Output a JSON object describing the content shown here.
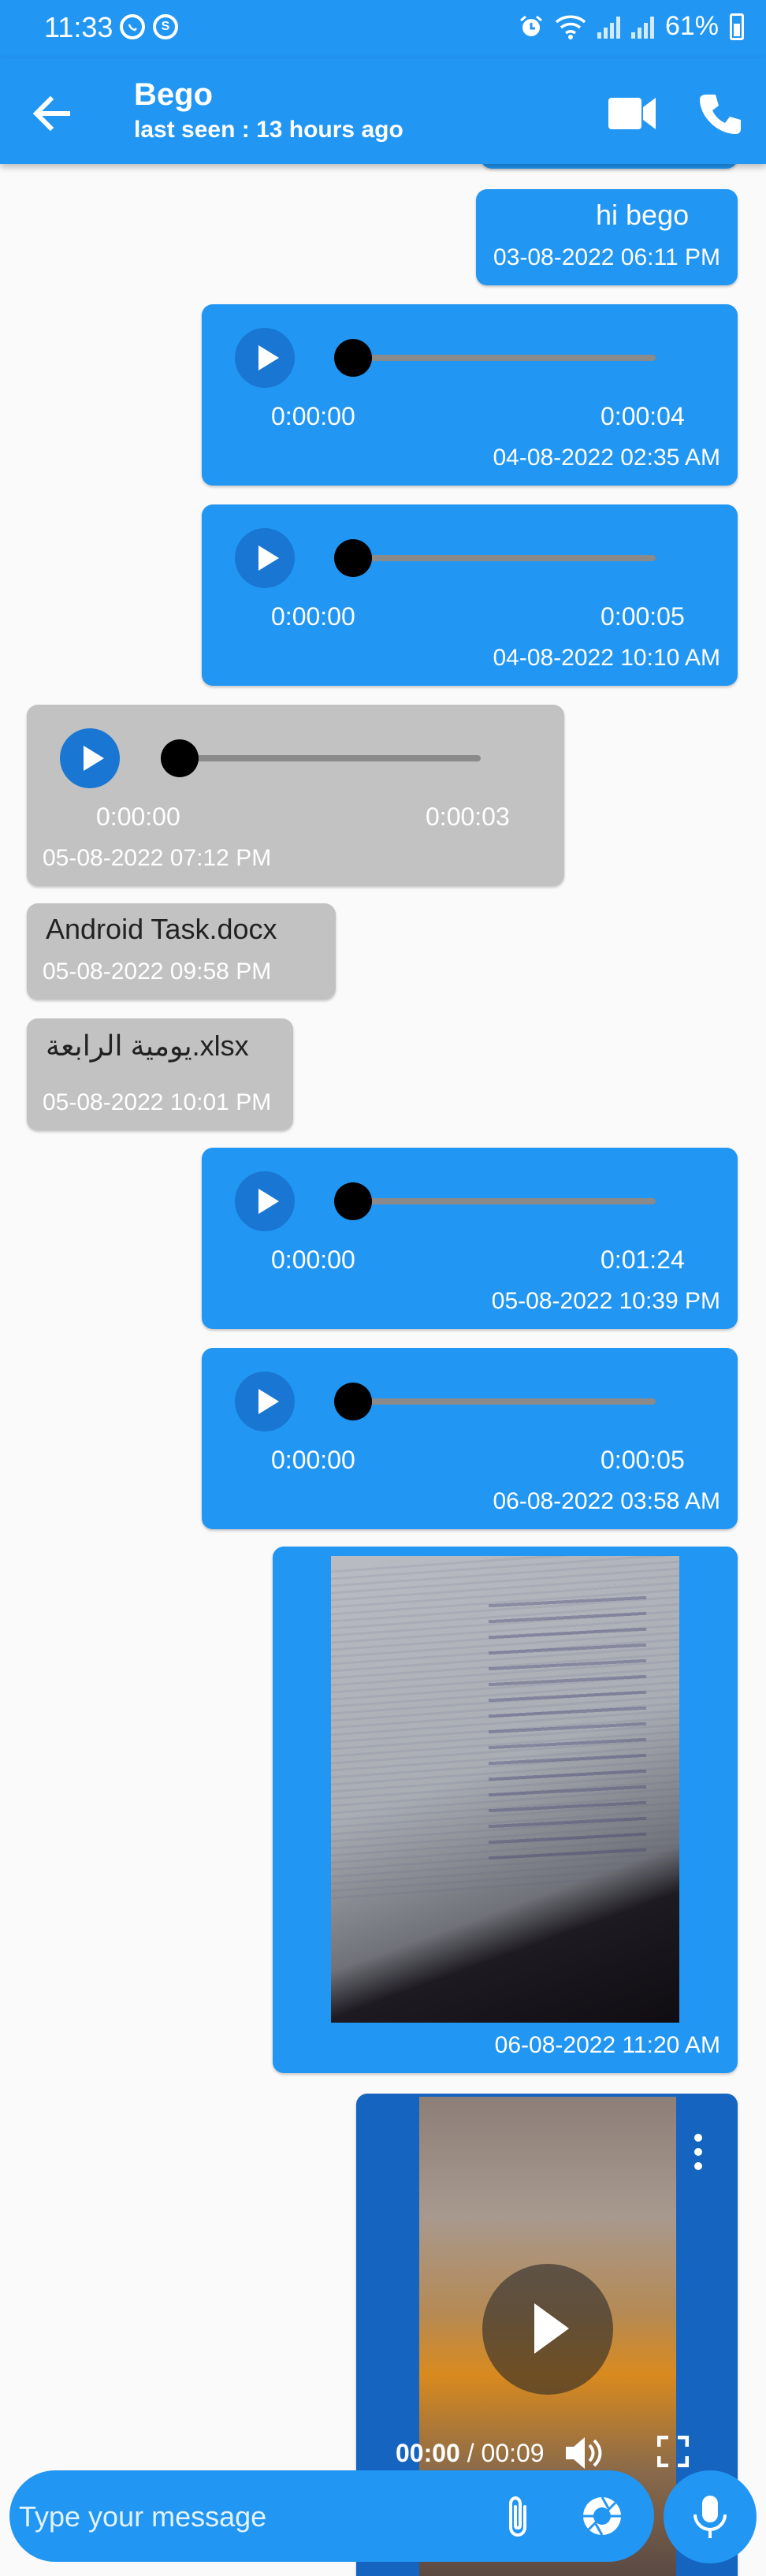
{
  "status_bar": {
    "time": "11:33",
    "battery": "61%",
    "icons": [
      "whatsapp-icon",
      "shield-s-icon",
      "alarm-icon",
      "wifi-icon",
      "signal-icon",
      "signal-icon",
      "battery-icon"
    ]
  },
  "app_bar": {
    "contact_name": "Bego",
    "last_seen": "last seen : 13 hours ago",
    "actions": [
      "back-arrow-icon",
      "video-call-icon",
      "phone-call-icon"
    ]
  },
  "messages": [
    {
      "type": "text",
      "direction": "sent",
      "text": "hi bego",
      "time": "03-08-2022 06:11 PM"
    },
    {
      "type": "audio",
      "direction": "sent",
      "position": "0:00:00",
      "duration": "0:00:04",
      "time": "04-08-2022 02:35 AM",
      "progress": 0
    },
    {
      "type": "audio",
      "direction": "sent",
      "position": "0:00:00",
      "duration": "0:00:05",
      "time": "04-08-2022 10:10 AM",
      "progress": 0
    },
    {
      "type": "audio",
      "direction": "received",
      "position": "0:00:00",
      "duration": "0:00:03",
      "time": "05-08-2022 07:12 PM",
      "progress": 0
    },
    {
      "type": "file",
      "direction": "received",
      "text": "Android Task.docx",
      "time": "05-08-2022 09:58 PM"
    },
    {
      "type": "file",
      "direction": "received",
      "text": "يومية الرابعة.xlsx",
      "time": "05-08-2022 10:01 PM"
    },
    {
      "type": "audio",
      "direction": "sent",
      "position": "0:00:00",
      "duration": "0:01:24",
      "time": "05-08-2022 10:39 PM",
      "progress": 0
    },
    {
      "type": "audio",
      "direction": "sent",
      "position": "0:00:00",
      "duration": "0:00:05",
      "time": "06-08-2022 03:58 AM",
      "progress": 0
    },
    {
      "type": "image",
      "direction": "sent",
      "time": "06-08-2022 11:20 AM"
    },
    {
      "type": "video",
      "direction": "sent",
      "current": "00:00",
      "total": "/ 00:09"
    }
  ],
  "composer": {
    "placeholder": "Type your message",
    "icons": [
      "attach-icon",
      "camera-icon",
      "mic-icon"
    ]
  },
  "colors": {
    "primary": "#2196f3",
    "play_button": "#1976d2",
    "received_bubble": "#c2c2c2",
    "background": "#fafafa"
  }
}
